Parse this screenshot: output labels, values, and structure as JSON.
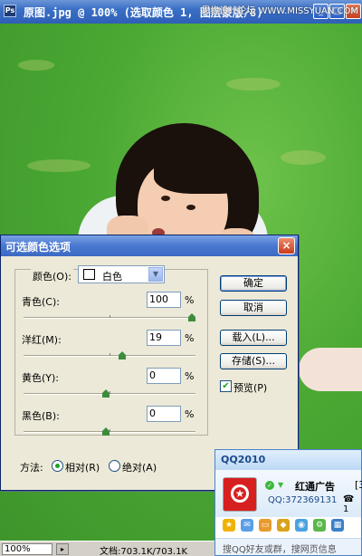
{
  "ps_window": {
    "title": "原图.jpg @ 100% (选取颜色 1, 图层蒙版/8)",
    "watermark": "思缘设计论坛 WWW.MISSYUAN.COM",
    "icon_text": "Ps"
  },
  "status_bar": {
    "zoom": "100%",
    "doc_info": "文档:703.1K/703.1K"
  },
  "dialog": {
    "title": "可选颜色选项",
    "color_label": "颜色(O):",
    "color_value": "白色",
    "sliders": [
      {
        "label": "青色(C):",
        "value": "100",
        "unit": "%",
        "fraction": 1.0
      },
      {
        "label": "洋红(M):",
        "value": "19",
        "unit": "%",
        "fraction": 0.595
      },
      {
        "label": "黄色(Y):",
        "value": "0",
        "unit": "%",
        "fraction": 0.5
      },
      {
        "label": "黑色(B):",
        "value": "0",
        "unit": "%",
        "fraction": 0.5
      }
    ],
    "buttons": {
      "ok": "确定",
      "cancel": "取消",
      "load": "载入(L)...",
      "save": "存储(S)..."
    },
    "preview": {
      "label": "预览(P)",
      "checked": true
    },
    "method": {
      "label": "方法:",
      "relative": "相对(R)",
      "absolute": "绝对(A)",
      "selected": "relative"
    }
  },
  "qq": {
    "title": "QQ2010",
    "name": "红通广告",
    "name_cut": "[3",
    "qq_number": "QQ:372369131",
    "phone_cut": "☎ 1",
    "footer": "搜QQ好友或群，搜网页信息"
  }
}
